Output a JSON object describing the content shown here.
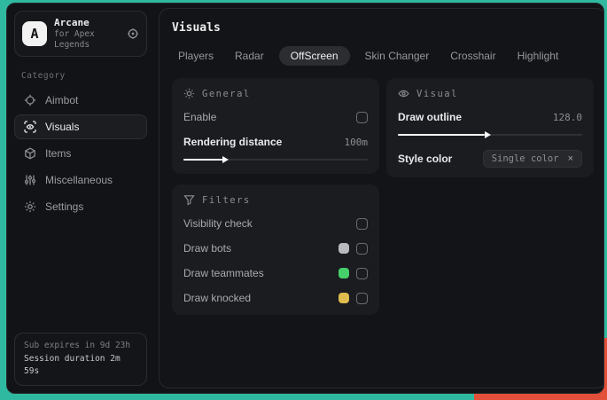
{
  "app": {
    "logo_letter": "A",
    "name": "Arcane",
    "subtitle": "for Apex Legends"
  },
  "sidebar": {
    "category_label": "Category",
    "items": [
      {
        "label": "Aimbot",
        "icon": "crosshair-icon"
      },
      {
        "label": "Visuals",
        "icon": "eye-scan-icon",
        "selected": true
      },
      {
        "label": "Items",
        "icon": "cube-icon"
      },
      {
        "label": "Miscellaneous",
        "icon": "sliders-icon"
      },
      {
        "label": "Settings",
        "icon": "gear-icon"
      }
    ],
    "footer": {
      "line1": "Sub expires in 9d 23h",
      "line2": "Session duration 2m 59s"
    }
  },
  "main": {
    "title": "Visuals",
    "tabs": [
      {
        "label": "Players"
      },
      {
        "label": "Radar"
      },
      {
        "label": "OffScreen",
        "selected": true
      },
      {
        "label": "Skin Changer"
      },
      {
        "label": "Crosshair"
      },
      {
        "label": "Highlight"
      }
    ],
    "panels": {
      "general": {
        "title": "General",
        "icon": "sun-icon",
        "enable": {
          "label": "Enable",
          "checked": false
        },
        "rendering": {
          "label": "Rendering distance",
          "value": "100m",
          "fill_pct": 21
        }
      },
      "filters": {
        "title": "Filters",
        "icon": "funnel-icon",
        "rows": [
          {
            "label": "Visibility check",
            "swatch": null,
            "checked": false
          },
          {
            "label": "Draw bots",
            "swatch": "#b9babc",
            "checked": false
          },
          {
            "label": "Draw teammates",
            "swatch": "#46d06b",
            "checked": false
          },
          {
            "label": "Draw knocked",
            "swatch": "#dfbc4e",
            "checked": false
          }
        ]
      },
      "visual": {
        "title": "Visual",
        "icon": "eye-icon",
        "outline": {
          "label": "Draw outline",
          "value": "128.0",
          "fill_pct": 47
        },
        "style": {
          "label": "Style color",
          "selected_option": "Single color",
          "clear_glyph": "×"
        }
      }
    }
  },
  "colors": {
    "wallpaper_teal": "#2fb9a0",
    "wallpaper_orange": "#e2503a",
    "window_bg": "#121316",
    "card_bg": "#1b1c20",
    "accent_text": "#e9eaeb",
    "muted_text": "#8b8e93",
    "swatch_gray": "#b9babc",
    "swatch_green": "#46d06b",
    "swatch_yellow": "#dfbc4e"
  }
}
